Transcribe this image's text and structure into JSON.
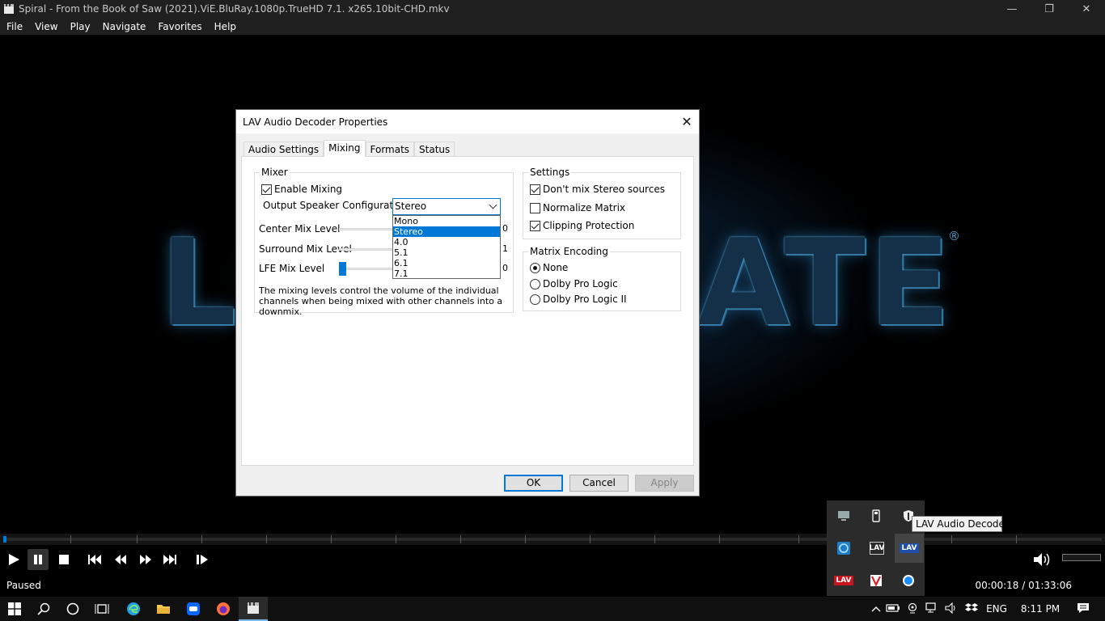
{
  "window": {
    "title": "Spiral - From the Book of Saw (2021).ViE.BluRay.1080p.TrueHD 7.1. x265.10bit-CHD.mkv",
    "minimize": "—",
    "maximize": "❐",
    "close": "✕"
  },
  "menu": [
    "File",
    "View",
    "Play",
    "Navigate",
    "Favorites",
    "Help"
  ],
  "video": {
    "logo_left": "L",
    "logo_right": "ATE",
    "reg_mark": "®"
  },
  "dialog": {
    "title": "LAV Audio Decoder Properties",
    "close": "✕",
    "tabs": [
      "Audio Settings",
      "Mixing",
      "Formats",
      "Status"
    ],
    "active_tab": "Mixing",
    "mixer": {
      "label": "Mixer",
      "enable_mixing": "Enable Mixing",
      "output_label": "Output Speaker Configuration:",
      "output_value": "Stereo",
      "options": [
        "Mono",
        "Stereo",
        "4.0",
        "5.1",
        "6.1",
        "7.1"
      ],
      "selected_option": "Stereo",
      "center_label": "Center Mix Level",
      "center_value": "0",
      "surround_label": "Surround Mix Level",
      "surround_value": "1",
      "lfe_label": "LFE Mix Level",
      "lfe_value": "0",
      "description": "The mixing levels control the volume of the individual channels when being mixed with other channels into a downmix."
    },
    "settings": {
      "label": "Settings",
      "dont_mix_stereo": "Don't mix Stereo sources",
      "dont_mix_stereo_checked": true,
      "normalize_matrix": "Normalize Matrix",
      "normalize_matrix_checked": false,
      "clipping_protection": "Clipping Protection",
      "clipping_protection_checked": true
    },
    "matrix": {
      "label": "Matrix Encoding",
      "none": "None",
      "dolby_pro_logic": "Dolby Pro Logic",
      "dolby_pro_logic_2": "Dolby Pro Logic II",
      "selected": "None"
    },
    "buttons": {
      "ok": "OK",
      "cancel": "Cancel",
      "apply": "Apply"
    }
  },
  "player": {
    "status": "Paused",
    "time": "00:00:18 / 01:33:06"
  },
  "tray_popup": {
    "tooltip": "LAV Audio Decoder",
    "icons": [
      "network-icon",
      "usb-icon",
      "security-icon",
      "intel-graphics-icon",
      "lav-video-icon",
      "lav-audio-icon",
      "lav-splitter-icon",
      "vlc-icon",
      "zalo-icon"
    ]
  },
  "taskbar": {
    "language": "ENG",
    "clock": "8:11 PM"
  },
  "colors": {
    "accent": "#0078d7",
    "dialog_bg": "#f0f0f0",
    "player_bg": "#1f1f1f"
  }
}
